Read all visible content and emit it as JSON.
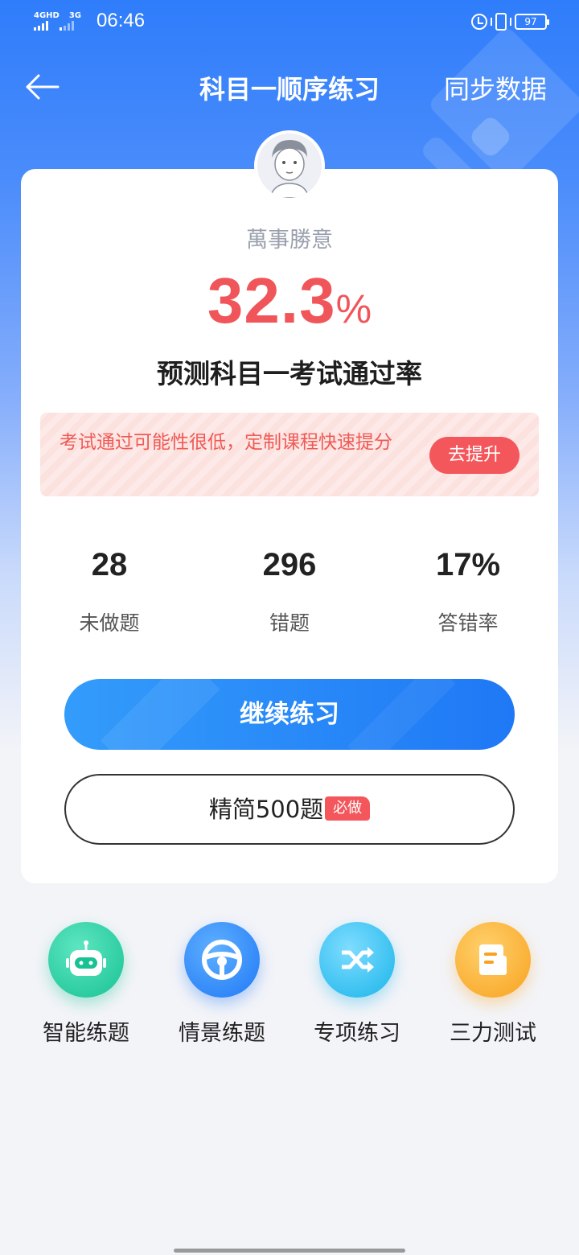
{
  "status_bar": {
    "net1": "4GHD",
    "net2": "3G",
    "time": "06:46",
    "battery": "97"
  },
  "header": {
    "title": "科目一顺序练习",
    "action": "同步数据"
  },
  "profile": {
    "nickname": "萬事勝意"
  },
  "pass_rate": {
    "value": "32.3",
    "unit": "%",
    "label": "预测科目一考试通过率"
  },
  "tip": {
    "text": "考试通过可能性很低，定制课程快速提分",
    "button": "去提升"
  },
  "stats": [
    {
      "value": "28",
      "label": "未做题"
    },
    {
      "value": "296",
      "label": "错题"
    },
    {
      "value": "17%",
      "label": "答错率"
    }
  ],
  "buttons": {
    "continue": "继续练习",
    "refined": "精简500题",
    "refined_badge": "必做"
  },
  "features": [
    {
      "label": "智能练题",
      "icon": "robot-icon",
      "color": "#22c9a0"
    },
    {
      "label": "情景练题",
      "icon": "steering-wheel-icon",
      "color": "#2b8cf8"
    },
    {
      "label": "专项练习",
      "icon": "shuffle-icon",
      "color": "#2fc3ef"
    },
    {
      "label": "三力测试",
      "icon": "document-icon",
      "color": "#fbaa2a"
    }
  ],
  "colors": {
    "accent_blue": "#1f78f5",
    "danger_red": "#f0555a"
  }
}
